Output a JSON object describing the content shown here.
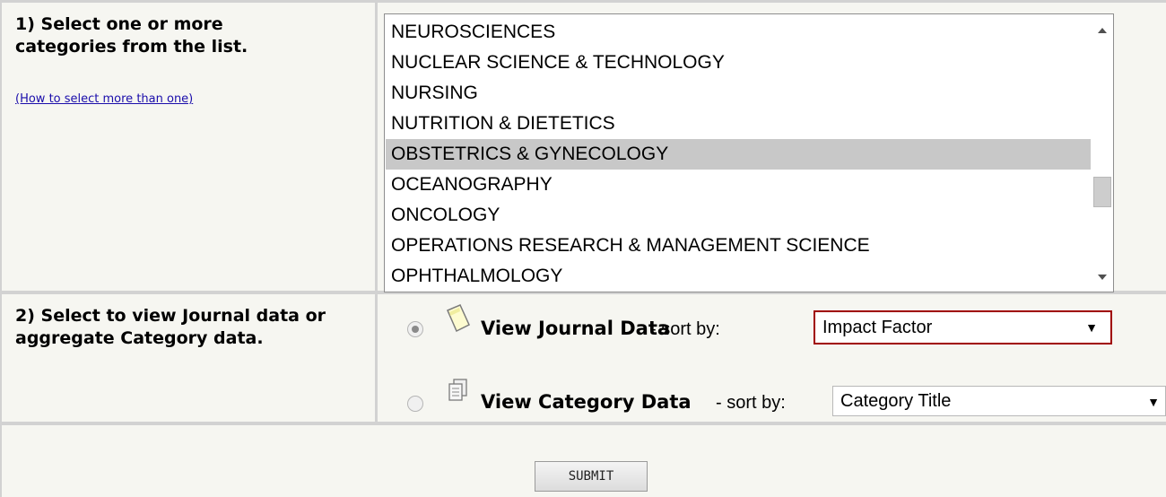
{
  "step1": {
    "label": "1) Select one or more categories from the list.",
    "help_link": "(How to select more than one)"
  },
  "categories": {
    "options": [
      "NEUROSCIENCES",
      "NUCLEAR SCIENCE & TECHNOLOGY",
      "NURSING",
      "NUTRITION & DIETETICS",
      "OBSTETRICS & GYNECOLOGY",
      "OCEANOGRAPHY",
      "ONCOLOGY",
      "OPERATIONS RESEARCH & MANAGEMENT SCIENCE",
      "OPHTHALMOLOGY"
    ],
    "selected": "OBSTETRICS & GYNECOLOGY"
  },
  "step2": {
    "label": "2) Select to view Journal data or aggregate Category data.",
    "journal": {
      "title": "View Journal Data",
      "sort_label": " - sort by:",
      "sort_value": "Impact Factor",
      "checked": true
    },
    "category": {
      "title": "View Category Data",
      "sort_label": " - sort by:",
      "sort_value": "Category Title",
      "checked": false
    }
  },
  "submit_label": "SUBMIT",
  "icons": {
    "journal": "journal-page-icon",
    "category": "category-pages-icon",
    "dropdown": "triangle-down"
  },
  "colors": {
    "cell_bg": "#f6f6f1",
    "grid": "#d2d2d2",
    "selected_option_bg": "#c8c8c8",
    "focus_border": "#a00000",
    "link": "#1a0dab"
  }
}
